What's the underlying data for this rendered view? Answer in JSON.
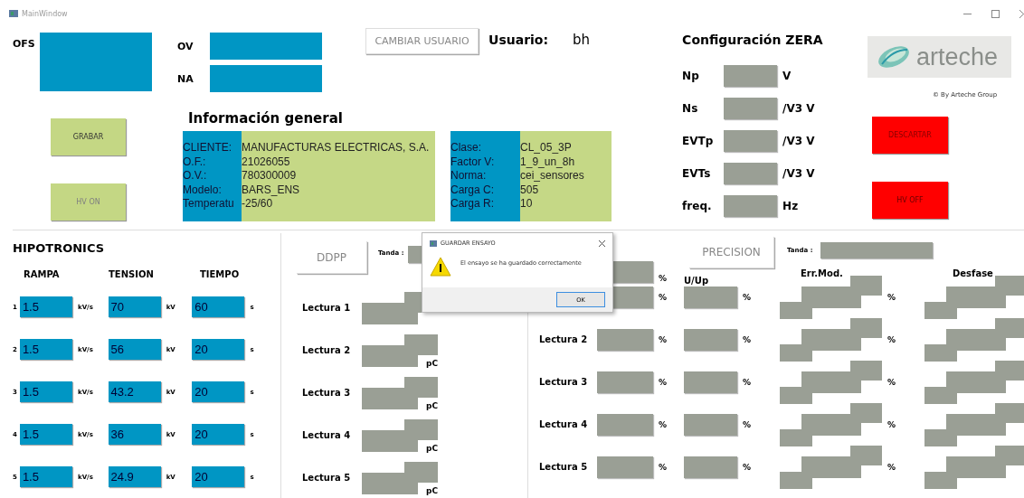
{
  "window": {
    "title": "MainWindow"
  },
  "ofs": {
    "label": "OFS"
  },
  "order_fields": [
    {
      "label": "OV"
    },
    {
      "label": "NA"
    }
  ],
  "left_buttons": [
    {
      "label": "GRABAR",
      "disabled": false
    },
    {
      "label": "HV ON",
      "disabled": true
    }
  ],
  "change_user_button": {
    "label": "CAMBIAR USUARIO"
  },
  "user": {
    "label": "Usuario:",
    "value": "bh"
  },
  "general_info": {
    "title": "Información general",
    "panels": [
      {
        "rows": [
          {
            "label": "CLIENTE:",
            "value": "MANUFACTURAS ELECTRICAS, S.A."
          },
          {
            "label": "O.F.:",
            "value": "21026055"
          },
          {
            "label": "O.V.:",
            "value": "780300009"
          },
          {
            "label": "Modelo:",
            "value": "BARS_ENS"
          },
          {
            "label": "Temperatu",
            "value": "-25/60"
          }
        ]
      },
      {
        "rows": [
          {
            "label": "Clase:",
            "value": "CL_05_3P"
          },
          {
            "label": "Factor V:",
            "value": "1_9_un_8h"
          },
          {
            "label": "Norma:",
            "value": "cei_sensores"
          },
          {
            "label": "Carga C:",
            "value": "505"
          },
          {
            "label": "Carga R:",
            "value": "10"
          }
        ]
      }
    ]
  },
  "zera": {
    "title": "Configuración ZERA",
    "rows": [
      {
        "label": "Np",
        "unit": "V"
      },
      {
        "label": "Ns",
        "unit": "/V3 V"
      },
      {
        "label": "EVTp",
        "unit": "/V3 V"
      },
      {
        "label": "EVTs",
        "unit": "/V3 V"
      },
      {
        "label": "freq.",
        "unit": "Hz"
      }
    ]
  },
  "logo": {
    "text": "arteche",
    "caption": "© By Arteche Group"
  },
  "right_buttons": [
    {
      "label": "DESCARTAR",
      "disabled": false
    },
    {
      "label": "HV OFF",
      "disabled": true
    }
  ],
  "hipotronics": {
    "title": "HIPOTRONICS",
    "columns": [
      "RAMPA",
      "TENSION",
      "TIEMPO"
    ],
    "rows": [
      {
        "index": "1",
        "rampa": "1.5",
        "rampa_unit": "kV/s",
        "tension": "70",
        "tension_unit": "kV",
        "tiempo": "60",
        "tiempo_unit": "s"
      },
      {
        "index": "2",
        "rampa": "1.5",
        "rampa_unit": "kV/s",
        "tension": "56",
        "tension_unit": "kV",
        "tiempo": "20",
        "tiempo_unit": "s"
      },
      {
        "index": "3",
        "rampa": "1.5",
        "rampa_unit": "kV/s",
        "tension": "43.2",
        "tension_unit": "kV",
        "tiempo": "20",
        "tiempo_unit": "s"
      },
      {
        "index": "4",
        "rampa": "1.5",
        "rampa_unit": "kV/s",
        "tension": "36",
        "tension_unit": "kV",
        "tiempo": "20",
        "tiempo_unit": "s"
      },
      {
        "index": "5",
        "rampa": "1.5",
        "rampa_unit": "kV/s",
        "tension": "24.9",
        "tension_unit": "kV",
        "tiempo": "20",
        "tiempo_unit": "s"
      }
    ]
  },
  "ddpp": {
    "button": "DDPP",
    "tanda_label": "Tanda :",
    "rows": [
      {
        "label": "Lectura 1"
      },
      {
        "label": "Lectura 2",
        "unit": "pC"
      },
      {
        "label": "Lectura 3",
        "unit": "pC"
      },
      {
        "label": "Lectura 4",
        "unit": "pC"
      },
      {
        "label": "Lectura 5",
        "unit": "pC"
      }
    ]
  },
  "precision": {
    "button": "PRECISION",
    "tanda_label": "Tanda :",
    "top_unit": "%",
    "columns": [
      "U/Up",
      "Err.Mod.",
      "Desfase"
    ],
    "rows": [
      {
        "units": [
          "%",
          "%",
          "%"
        ]
      },
      {
        "label": "Lectura 2",
        "units": [
          "%",
          "%",
          "%"
        ]
      },
      {
        "label": "Lectura 3",
        "units": [
          "%",
          "%",
          "%"
        ]
      },
      {
        "label": "Lectura 4",
        "units": [
          "%",
          "%",
          "%"
        ]
      },
      {
        "label": "Lectura 5",
        "units": [
          "%",
          "%",
          "%"
        ]
      }
    ]
  },
  "dialog": {
    "title": "GUARDAR ENSAYO",
    "message": "El ensayo se ha guardado correctamente",
    "button": "OK"
  }
}
